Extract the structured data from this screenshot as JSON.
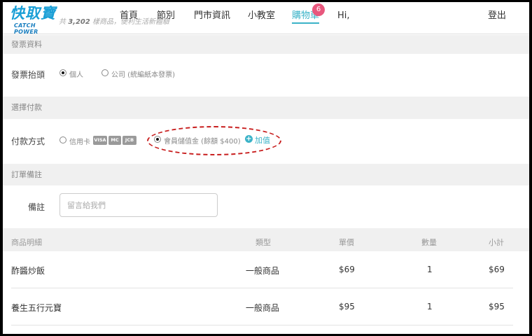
{
  "header": {
    "logo_main": "快取寶",
    "logo_sub": "CATCH POWER",
    "tagline_prefix": "共",
    "tagline_count": "3,202",
    "tagline_suffix": "樣商品，便利生活新體驗",
    "nav": {
      "home": "首頁",
      "category": "節別",
      "stores": "門市資訊",
      "classroom": "小教室",
      "cart": "購物車",
      "greeting": "Hi,",
      "logout": "登出"
    },
    "cart_count": "6"
  },
  "invoice": {
    "section_title": "發票資料",
    "label": "發票抬頭",
    "options": [
      {
        "label": "個人",
        "selected": true
      },
      {
        "label": "公司 (統編紙本發票)",
        "selected": false
      }
    ]
  },
  "payment": {
    "section_title": "選擇付款",
    "label": "付款方式",
    "credit_card": {
      "label": "信用卡",
      "selected": false,
      "cards": [
        "VISA",
        "MC",
        "JCB"
      ]
    },
    "member_balance": {
      "label": "會員儲值金 (餘額 $400)",
      "selected": true
    },
    "topup_label": "加值"
  },
  "notes": {
    "section_title": "訂單備註",
    "label": "備註",
    "placeholder": "留言給我們"
  },
  "items": {
    "headers": {
      "name": "商品明細",
      "type": "類型",
      "price": "單價",
      "qty": "數量",
      "subtotal": "小計"
    },
    "rows": [
      {
        "name": "酢醬炒飯",
        "type": "一般商品",
        "price": "$69",
        "qty": "1",
        "subtotal": "$69"
      },
      {
        "name": "養生五行元寶",
        "type": "一般商品",
        "price": "$95",
        "qty": "1",
        "subtotal": "$95"
      }
    ]
  },
  "colors": {
    "accent": "#3bb3c8",
    "badge": "#e8577d",
    "highlight": "#c81e1e",
    "brand": "#1a9fd6"
  }
}
